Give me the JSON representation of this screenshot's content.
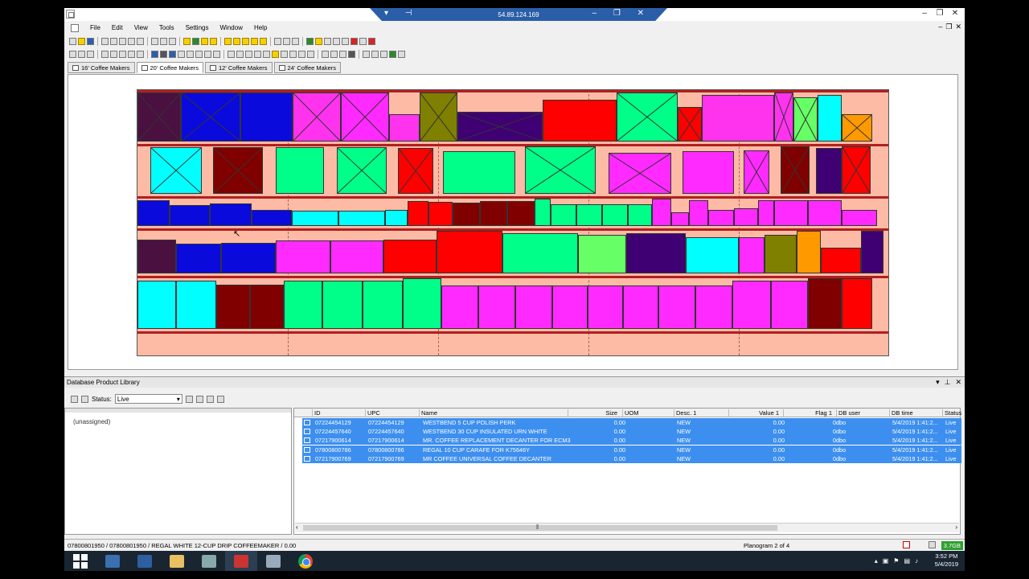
{
  "window": {
    "rdp_title": "54.89.124.169",
    "menu": [
      "File",
      "Edit",
      "View",
      "Tools",
      "Settings",
      "Window",
      "Help"
    ]
  },
  "tabs": [
    {
      "label": "16' Coffee Makers",
      "active": false
    },
    {
      "label": "20' Coffee Makers",
      "active": true
    },
    {
      "label": "12' Coffee Makers",
      "active": false
    },
    {
      "label": "24' Coffee Makers",
      "active": false
    }
  ],
  "library": {
    "title": "Database Product Library",
    "status_label": "Status:",
    "status_value": "Live",
    "tree_item": "(unassigned)",
    "columns": [
      "ID",
      "UPC",
      "Name",
      "Size",
      "UOM",
      "Desc. 1",
      "Value 1",
      "Flag 1",
      "DB user",
      "DB time",
      "Status"
    ],
    "rows": [
      {
        "id": "07224454129",
        "upc": "07224454129",
        "name": "WESTBEND 5 CUP POLISH PERK",
        "size": "0.00",
        "desc": "NEW",
        "value": "0.00",
        "flag": "0",
        "user": "dbo",
        "time": "5/4/2019 1:41:2...",
        "status": "Live"
      },
      {
        "id": "07224457640",
        "upc": "07224457640",
        "name": "WESTBEND 30 CUP     INSULATED URN WHITE",
        "size": "0.00",
        "desc": "NEW",
        "value": "0.00",
        "flag": "0",
        "user": "dbo",
        "time": "5/4/2019 1:41:2...",
        "status": "Live"
      },
      {
        "id": "07217900614",
        "upc": "07217900614",
        "name": "MR. COFFEE REPLACEMENT DECANTER FOR ECM3",
        "size": "0.00",
        "desc": "NEW",
        "value": "0.00",
        "flag": "0",
        "user": "dbo",
        "time": "5/4/2019 1:41:2...",
        "status": "Live"
      },
      {
        "id": "07800800786",
        "upc": "07800800786",
        "name": "REGAL 10 CUP CARAFE  FOR K75646Y",
        "size": "0.00",
        "desc": "NEW",
        "value": "0.00",
        "flag": "0",
        "user": "dbo",
        "time": "5/4/2019 1:41:2...",
        "status": "Live"
      },
      {
        "id": "07217900769",
        "upc": "07217900769",
        "name": "MR COFFEE UNIVERSAL COFFEE DECANTER",
        "size": "0.00",
        "desc": "NEW",
        "value": "0.00",
        "flag": "0",
        "user": "dbo",
        "time": "5/4/2019 1:41:2...",
        "status": "Live"
      }
    ]
  },
  "statusbar": {
    "left": "07800801950 / 07800801950 / REGAL WHITE 12-CUP DRIP COFFEEMAKER / 0.00",
    "planogram": "Planogram 2 of 4",
    "memory": "3.7GB"
  },
  "taskbar": {
    "time": "3:52 PM",
    "date": "5/4/2019"
  },
  "colors": {
    "fixture_bg": "#fdbba5",
    "shelf": "#b02020",
    "selection": "#3d8fef",
    "product_palette": [
      "#4a1040",
      "#0a0adc",
      "#ff2aff",
      "#ff33ee",
      "#7f7f00",
      "#3f0073",
      "#ff0000",
      "#00ff88",
      "#00ffff",
      "#800000",
      "#ff9900",
      "#66ff66",
      "#000080"
    ]
  },
  "products": [
    {
      "row": 0,
      "items": [
        [
          "#4a1040",
          54,
          1
        ],
        [
          "#0a0adc",
          74,
          1
        ],
        [
          "#0a0adc",
          65,
          1
        ],
        [
          "#ff33ee",
          60,
          1
        ],
        [
          "#ff2aff",
          60,
          1
        ],
        [
          "#ff33ee",
          38,
          0.55
        ],
        [
          "#7f7f00",
          47,
          1
        ],
        [
          "#3f0073",
          106,
          0.6
        ],
        [
          "#ff0000",
          92,
          0.85
        ],
        [
          "#00ff88",
          76,
          1
        ],
        [
          "#ff0000",
          30,
          0.7
        ],
        [
          "#ff33ee",
          90,
          0.95
        ],
        [
          "#ff33ee",
          24,
          1
        ],
        [
          "#66ff66",
          30,
          0.9
        ],
        [
          "#00ffff",
          30,
          0.95
        ],
        [
          "#ff9900",
          38,
          0.55
        ]
      ]
    },
    {
      "row": 1,
      "items": [
        [
          "#00ffff",
          64,
          0.98,
          "g16"
        ],
        [
          "#800000",
          62,
          0.98,
          "g14"
        ],
        [
          "#00ff88",
          60,
          0.98,
          "g16"
        ],
        [
          "#00ff88",
          62,
          0.98,
          "g16"
        ],
        [
          "#ff0000",
          44,
          0.96,
          "g14"
        ],
        [
          "#00ff88",
          90,
          0.9,
          "g12"
        ],
        [
          "#00ff88",
          88,
          1,
          "g12"
        ],
        [
          "#ff2aff",
          78,
          0.86,
          "g16"
        ],
        [
          "#ff2aff",
          64,
          0.9,
          "g14"
        ],
        [
          "#ff2aff",
          32,
          0.92,
          "g12"
        ],
        [
          "#800000",
          36,
          1,
          "g14"
        ],
        [
          "#3f0073",
          32,
          0.96,
          "g8"
        ],
        [
          "#ff0000",
          36,
          1,
          "g0"
        ]
      ]
    },
    {
      "row": 2,
      "items": [
        [
          "#0a0adc",
          40,
          0.95
        ],
        [
          "#0a0adc",
          50,
          0.75
        ],
        [
          "#0a0adc",
          52,
          0.82
        ],
        [
          "#0a0adc",
          50,
          0.58
        ],
        [
          "#00ffff",
          58,
          0.55
        ],
        [
          "#00ffff",
          58,
          0.55
        ],
        [
          "#00ffff",
          28,
          0.6
        ],
        [
          "#ff0000",
          26,
          0.92
        ],
        [
          "#ff0000",
          30,
          0.88
        ],
        [
          "#800000",
          34,
          0.84
        ],
        [
          "#800000",
          34,
          0.92
        ],
        [
          "#800000",
          34,
          0.9
        ],
        [
          "#00ff88",
          20,
          1
        ],
        [
          "#00ff88",
          32,
          0.8
        ],
        [
          "#00ff88",
          32,
          0.8
        ],
        [
          "#00ff88",
          32,
          0.8
        ],
        [
          "#00ff88",
          30,
          0.8
        ],
        [
          "#ff2aff",
          24,
          1
        ],
        [
          "#ff2aff",
          22,
          0.5
        ],
        [
          "#ff2aff",
          24,
          0.95
        ],
        [
          "#ff2aff",
          32,
          0.6
        ],
        [
          "#ff2aff",
          30,
          0.65
        ],
        [
          "#ff2aff",
          20,
          0.95
        ],
        [
          "#ff2aff",
          42,
          0.95
        ],
        [
          "#ff2aff",
          42,
          0.95
        ],
        [
          "#ff2aff",
          44,
          0.6
        ]
      ]
    },
    {
      "row": 3,
      "items": [
        [
          "#4a1040",
          48,
          0.8
        ],
        [
          "#0a0adc",
          56,
          0.7
        ],
        [
          "#0a0adc",
          68,
          0.72
        ],
        [
          "#ff2aff",
          68,
          0.78
        ],
        [
          "#ff2aff",
          66,
          0.78
        ],
        [
          "#ff0000",
          66,
          0.8
        ],
        [
          "#ff0000",
          82,
          1
        ],
        [
          "#00ff88",
          94,
          0.95
        ],
        [
          "#66ff66",
          60,
          0.9
        ],
        [
          "#3f0073",
          74,
          0.95
        ],
        [
          "#00ffff",
          66,
          0.85
        ],
        [
          "#ff2aff",
          32,
          0.85
        ],
        [
          "#7f7f00",
          40,
          0.9
        ],
        [
          "#ff9900",
          30,
          1
        ],
        [
          "#ff0000",
          50,
          0.6
        ],
        [
          "#3f0073",
          28,
          1
        ]
      ]
    },
    {
      "row": 4,
      "items": [
        [
          "#00ffff",
          48,
          0.95
        ],
        [
          "#00ffff",
          50,
          0.95
        ],
        [
          "#800000",
          42,
          0.87
        ],
        [
          "#800000",
          42,
          0.87
        ],
        [
          "#00ff88",
          48,
          0.95
        ],
        [
          "#00ff88",
          50,
          0.95
        ],
        [
          "#00ff88",
          50,
          0.95
        ],
        [
          "#00ff88",
          48,
          1
        ],
        [
          "#ff2aff",
          46,
          0.85
        ],
        [
          "#ff2aff",
          46,
          0.85
        ],
        [
          "#ff2aff",
          46,
          0.85
        ],
        [
          "#ff2aff",
          44,
          0.85
        ],
        [
          "#ff2aff",
          44,
          0.85
        ],
        [
          "#ff2aff",
          44,
          0.85
        ],
        [
          "#ff2aff",
          46,
          0.85
        ],
        [
          "#ff2aff",
          46,
          0.85
        ],
        [
          "#ff2aff",
          48,
          0.95
        ],
        [
          "#ff2aff",
          46,
          0.95
        ],
        [
          "#800000",
          42,
          1
        ],
        [
          "#ff0000",
          38,
          1
        ]
      ]
    }
  ]
}
